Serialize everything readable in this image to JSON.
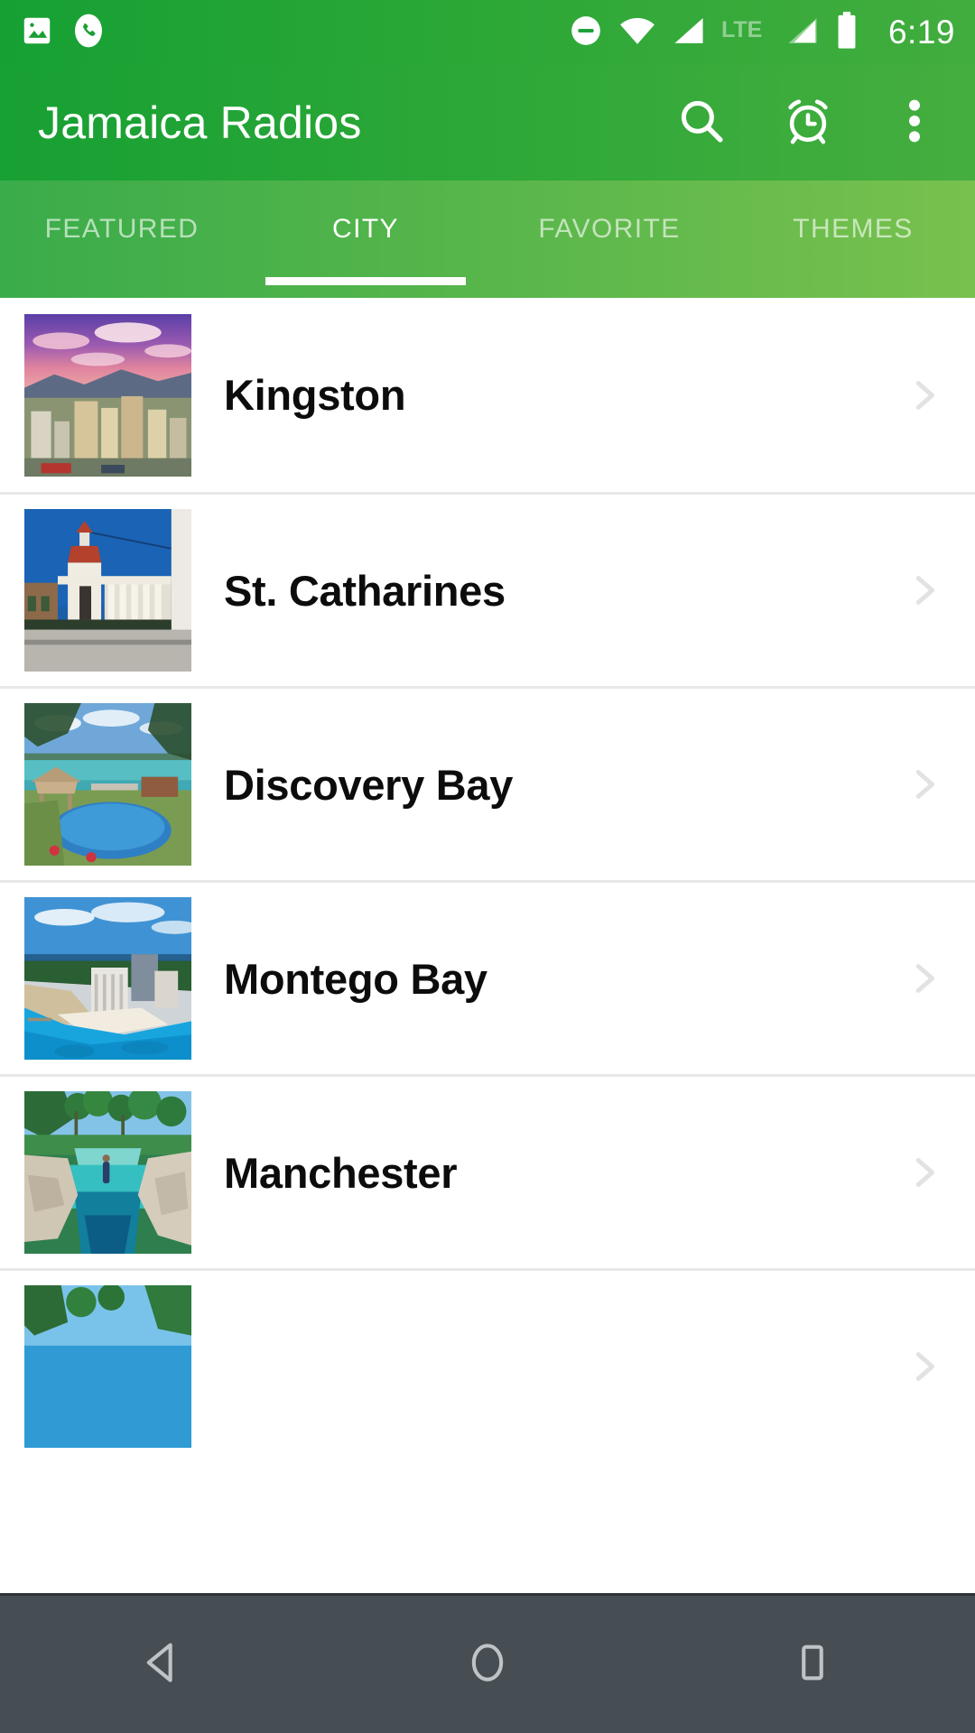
{
  "statusbar": {
    "clock": "6:19",
    "left_icons": [
      {
        "name": "image-icon",
        "label": "image"
      },
      {
        "name": "missed-call-icon",
        "label": "phone"
      }
    ],
    "right_icons": [
      {
        "name": "do-not-disturb-icon",
        "label": "do not disturb"
      },
      {
        "name": "wifi-icon",
        "label": "wifi"
      },
      {
        "name": "signal-icon-1",
        "label": "signal"
      },
      {
        "name": "lte-label",
        "label": "LTE"
      },
      {
        "name": "signal-icon-2",
        "label": "signal"
      },
      {
        "name": "battery-icon",
        "label": "battery"
      }
    ],
    "network_type": "LTE"
  },
  "toolbar": {
    "title": "Jamaica Radios",
    "search_label": "Search",
    "timer_label": "Sleep timer",
    "overflow_label": "More options"
  },
  "tabs": [
    {
      "label": "FEATURED",
      "active": false
    },
    {
      "label": "CITY",
      "active": true
    },
    {
      "label": "FAVORITE",
      "active": false
    },
    {
      "label": "THEMES",
      "active": false
    }
  ],
  "cities": [
    {
      "name": "Kingston",
      "image": "kingston-cityscape-sunset"
    },
    {
      "name": "St. Catharines",
      "image": "st-catharines-rotunda"
    },
    {
      "name": "Discovery Bay",
      "image": "discovery-bay-pool-gazebo"
    },
    {
      "name": "Montego Bay",
      "image": "montego-bay-beach"
    },
    {
      "name": "Manchester",
      "image": "manchester-blue-lagoon"
    },
    {
      "name": "",
      "image": "partial-next-row"
    }
  ],
  "navbar": {
    "back_label": "Back",
    "home_label": "Home",
    "recents_label": "Recents"
  },
  "colors": {
    "toolbar_green_start": "#17a033",
    "toolbar_green_end": "#45ae3f",
    "tab_green_start": "#3aac4a",
    "tab_green_end": "#78c14e",
    "accent_white": "#ffffff",
    "navbar_gray": "#464e53",
    "divider": "#e8e8e8",
    "text_primary": "#0c0c0c",
    "chevron_gray": "#e2e2e2"
  }
}
